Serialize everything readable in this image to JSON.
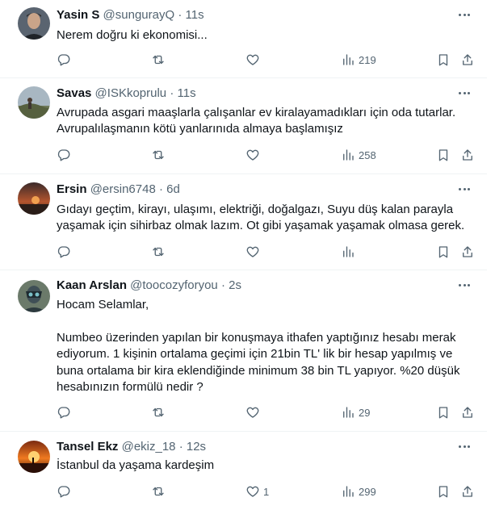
{
  "tweets": [
    {
      "name": "Yasin S",
      "handle": "@sungurayQ",
      "sep": "·",
      "time": "11s",
      "text": "Nerem doğru ki ekonomisi...",
      "replies": "",
      "retweets": "",
      "likes": "",
      "views": "219"
    },
    {
      "name": "Savas",
      "handle": "@ISKkoprulu",
      "sep": "·",
      "time": "11s",
      "text": "Avrupada asgari maaşlarla çalışanlar ev kiralayamadıkları için oda tutarlar.\nAvrupalılaşmanın kötü yanlarınıda almaya başlamışız",
      "replies": "",
      "retweets": "",
      "likes": "",
      "views": "258"
    },
    {
      "name": "Ersin",
      "handle": "@ersin6748",
      "sep": "·",
      "time": "6d",
      "text": "Gıdayı geçtim, kirayı, ulaşımı, elektriği, doğalgazı, Suyu düş kalan parayla\nyaşamak için sihirbaz olmak lazım. Ot gibi yaşamak yaşamak olmasa gerek.",
      "replies": "",
      "retweets": "",
      "likes": "",
      "views": ""
    },
    {
      "name": "Kaan Arslan",
      "handle": "@toocozyforyou",
      "sep": "·",
      "time": "2s",
      "text": "Hocam Selamlar,\n\nNumbeo üzerinden yapılan bir konuşmaya ithafen yaptığınız hesabı merak\nediyorum. 1 kişinin ortalama geçimi için 21bin TL' lik bir hesap yapılmış ve\nbuna ortalama bir kira eklendiğinde minimum 38 bin TL yapıyor. %20 düşük\nhesabınızın formülü nedir ?",
      "replies": "",
      "retweets": "",
      "likes": "",
      "views": "29"
    },
    {
      "name": "Tansel Ekz",
      "handle": "@ekiz_18",
      "sep": "·",
      "time": "12s",
      "text": "İstanbul da yaşama kardeşim",
      "replies": "",
      "retweets": "",
      "likes": "1",
      "views": "299"
    }
  ],
  "icons": {
    "reply": "reply-icon",
    "retweet": "retweet-icon",
    "like": "like-icon",
    "views": "views-icon",
    "bookmark": "bookmark-icon",
    "share": "share-icon",
    "more": "more-options-icon"
  },
  "colors": {
    "text": "#0f1419",
    "secondary": "#536471",
    "divider": "#eff3f4"
  }
}
